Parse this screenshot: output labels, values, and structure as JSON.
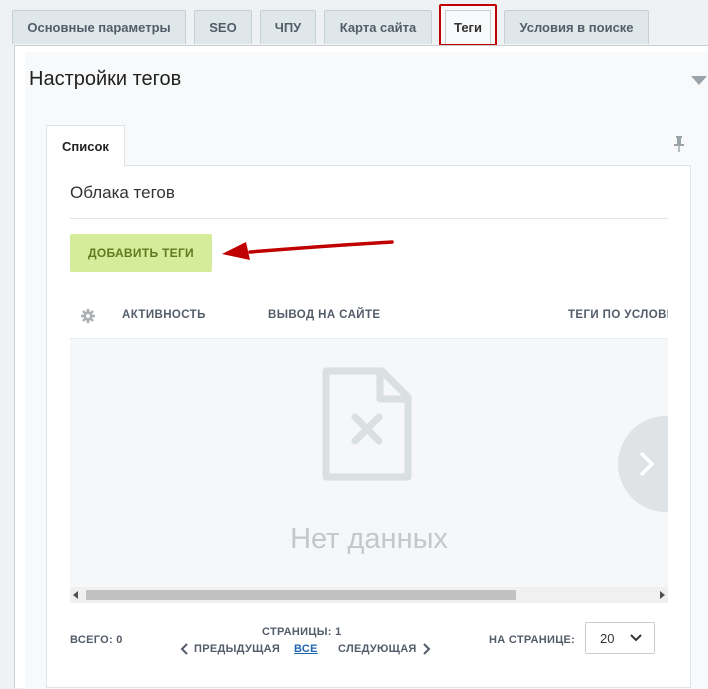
{
  "tabs": [
    {
      "label": "Основные параметры",
      "active": false
    },
    {
      "label": "SEO",
      "active": false
    },
    {
      "label": "ЧПУ",
      "active": false
    },
    {
      "label": "Карта сайта",
      "active": false
    },
    {
      "label": "Теги",
      "active": true
    },
    {
      "label": "Условия в поиске",
      "active": false
    }
  ],
  "panel": {
    "title": "Настройки тегов",
    "subtab": "Список",
    "card": {
      "title": "Облака тегов",
      "add_button": "ДОБАВИТЬ ТЕГИ",
      "columns": [
        "АКТИВНОСТЬ",
        "ВЫВОД НА САЙТЕ",
        "ТЕГИ ПО УСЛОВИ"
      ],
      "empty_text": "Нет данных"
    },
    "footer": {
      "total_label": "ВСЕГО:",
      "total_value": "0",
      "pages_label": "СТРАНИЦЫ:",
      "pages_value": "1",
      "prev_label": "ПРЕДЫДУЩАЯ",
      "all_label": "ВСЕ",
      "next_label": "СЛЕДУЮЩАЯ",
      "per_page_label": "НА СТРАНИЦЕ:",
      "per_page_value": "20"
    }
  },
  "colors": {
    "active_tab_border": "#c00000",
    "add_button_bg": "#d5ec9a",
    "add_button_text": "#5f7a1f",
    "arrow": "#c00000",
    "link": "#2067b0"
  },
  "icons": [
    "gear-icon",
    "pin-icon",
    "no-data-file-icon",
    "chevron-right-icon",
    "chevron-left-icon",
    "chevron-down-icon",
    "collapse-triangle-icon"
  ]
}
